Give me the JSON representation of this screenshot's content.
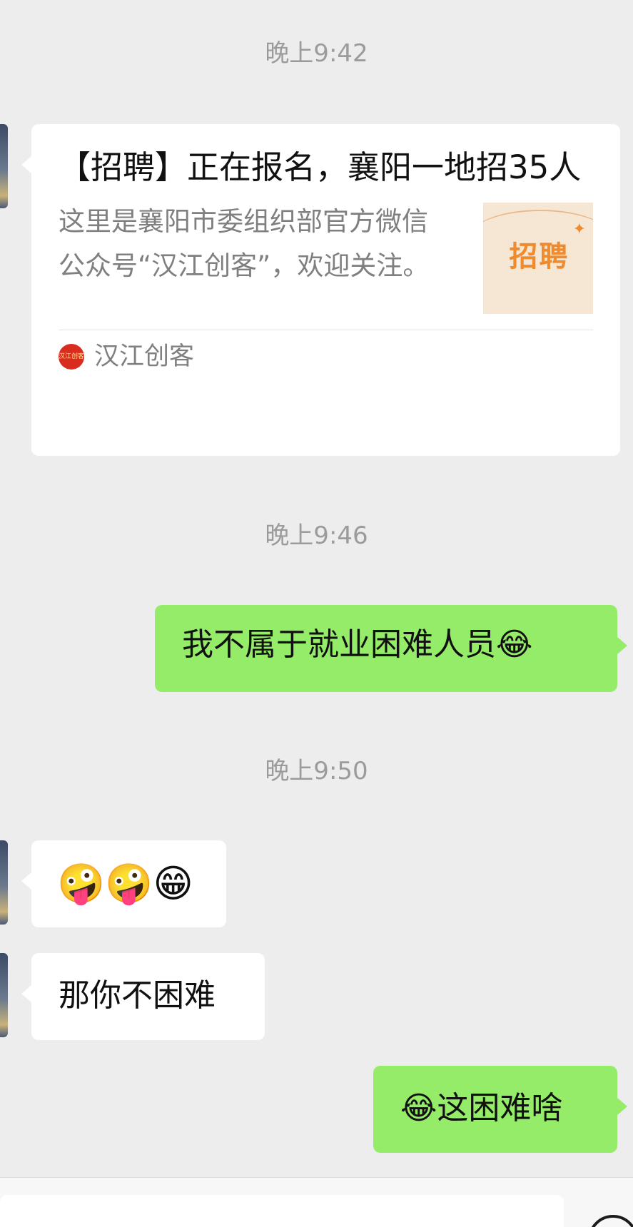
{
  "timestamps": [
    "晚上9:42",
    "晚上9:46",
    "晚上9:50"
  ],
  "link_card": {
    "title": "【招聘】正在报名，襄阳一地招35人",
    "description": "这里是襄阳市委组织部官方微信公众号“汉江创客”，欢迎关注。",
    "thumbnail_text": "招聘",
    "source_name": "汉江创客",
    "source_logo_text": "汉江创客"
  },
  "messages": [
    {
      "from": "me",
      "text": "我不属于就业困难人员😂"
    },
    {
      "from": "other",
      "text": "🤪🤪😁"
    },
    {
      "from": "other",
      "text": "那你不困难"
    },
    {
      "from": "me",
      "text": "😂这困难啥"
    }
  ],
  "input_bar": {
    "placeholder": "",
    "emoji_button_icon": "smiley-face-icon"
  },
  "colors": {
    "background": "#ededed",
    "incoming_bubble": "#ffffff",
    "outgoing_bubble": "#95ec69",
    "timestamp": "#9b9b9b"
  }
}
